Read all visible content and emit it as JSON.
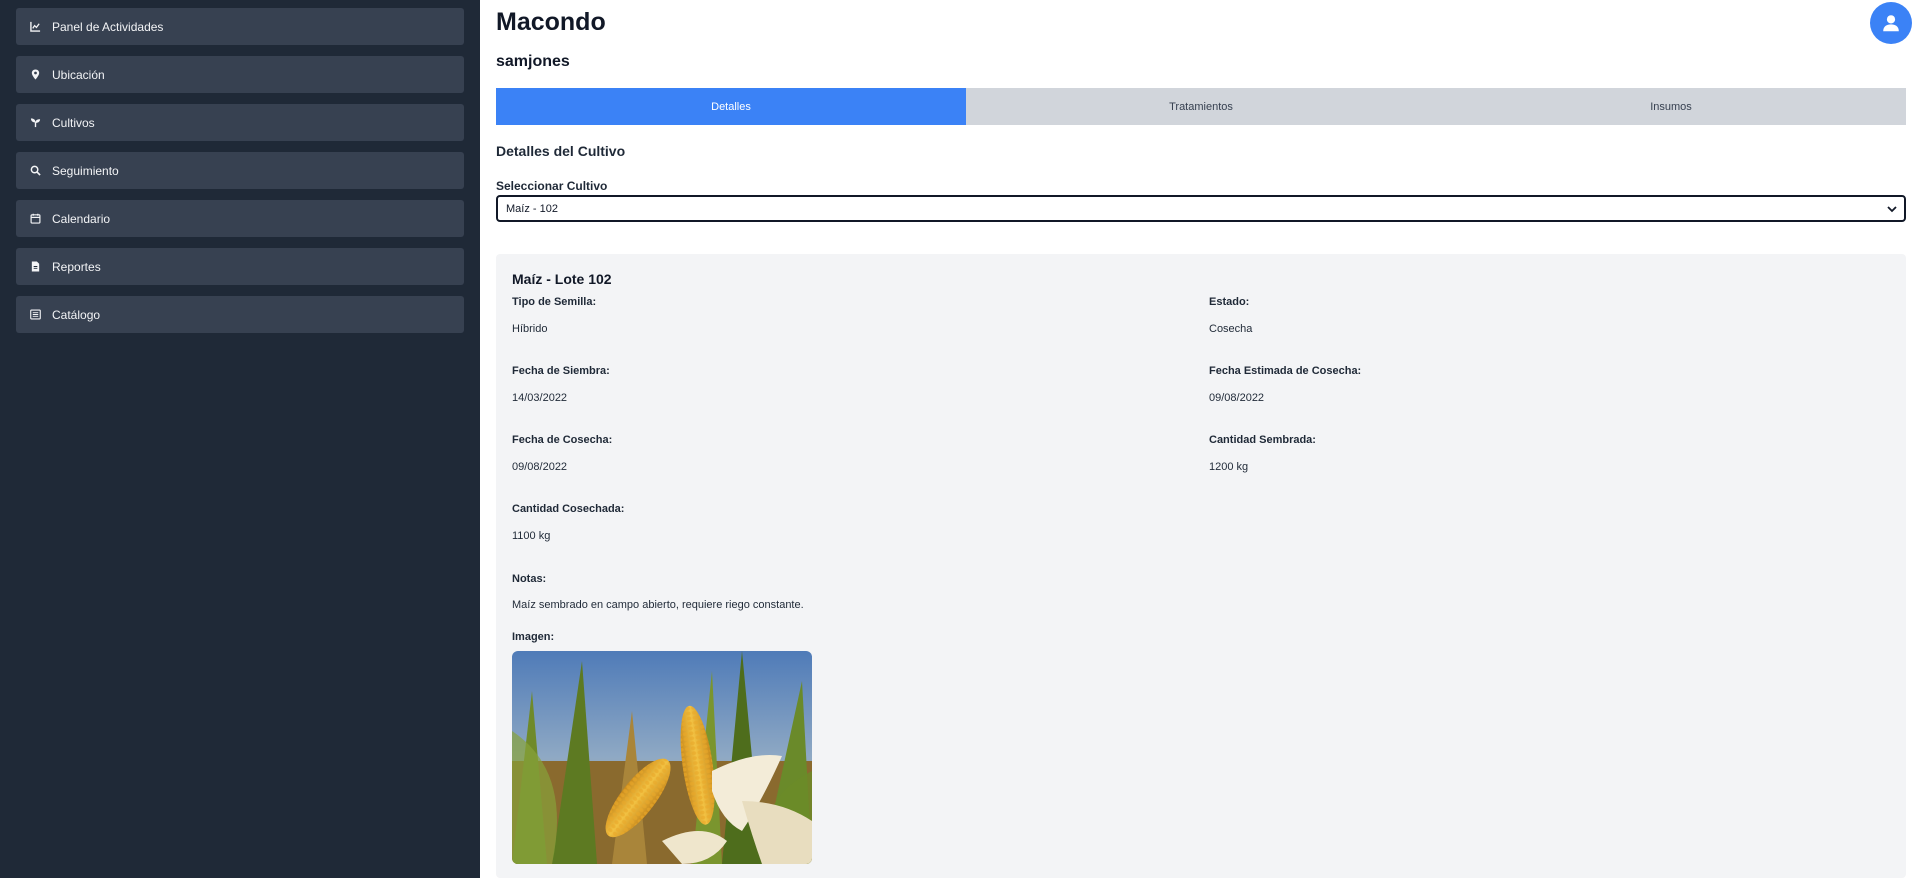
{
  "sidebar": {
    "items": [
      {
        "label": "Panel de Actividades",
        "icon": "chart-line-icon"
      },
      {
        "label": "Ubicación",
        "icon": "map-pin-icon"
      },
      {
        "label": "Cultivos",
        "icon": "seedling-icon"
      },
      {
        "label": "Seguimiento",
        "icon": "search-icon"
      },
      {
        "label": "Calendario",
        "icon": "calendar-icon"
      },
      {
        "label": "Reportes",
        "icon": "file-icon"
      },
      {
        "label": "Catálogo",
        "icon": "list-icon"
      }
    ]
  },
  "header": {
    "title": "Macondo",
    "username": "samjones"
  },
  "tabs": [
    {
      "label": "Detalles",
      "active": true
    },
    {
      "label": "Tratamientos",
      "active": false
    },
    {
      "label": "Insumos",
      "active": false
    }
  ],
  "details": {
    "section_title": "Detalles del Cultivo",
    "select_label": "Seleccionar Cultivo",
    "select_value": "Maíz - 102"
  },
  "card": {
    "title": "Maíz - Lote 102",
    "fields": {
      "seed_type": {
        "label": "Tipo de Semilla:",
        "value": "Híbrido"
      },
      "status": {
        "label": "Estado:",
        "value": "Cosecha"
      },
      "sowing_date": {
        "label": "Fecha de Siembra:",
        "value": "14/03/2022"
      },
      "estimated_harvest": {
        "label": "Fecha Estimada de Cosecha:",
        "value": "09/08/2022"
      },
      "harvest_date": {
        "label": "Fecha de Cosecha:",
        "value": "09/08/2022"
      },
      "sown_quantity": {
        "label": "Cantidad Sembrada:",
        "value": "1200 kg"
      },
      "harvested_quantity": {
        "label": "Cantidad Cosechada:",
        "value": "1100 kg"
      },
      "notes": {
        "label": "Notas:",
        "value": "Maíz sembrado en campo abierto, requiere riego constante."
      }
    },
    "image_label": "Imagen:"
  },
  "colors": {
    "sidebar_bg": "#1f2937",
    "nav_item_bg": "#374151",
    "accent": "#3b82f6",
    "tab_inactive": "#d1d5db",
    "card_bg": "#f3f4f6"
  }
}
